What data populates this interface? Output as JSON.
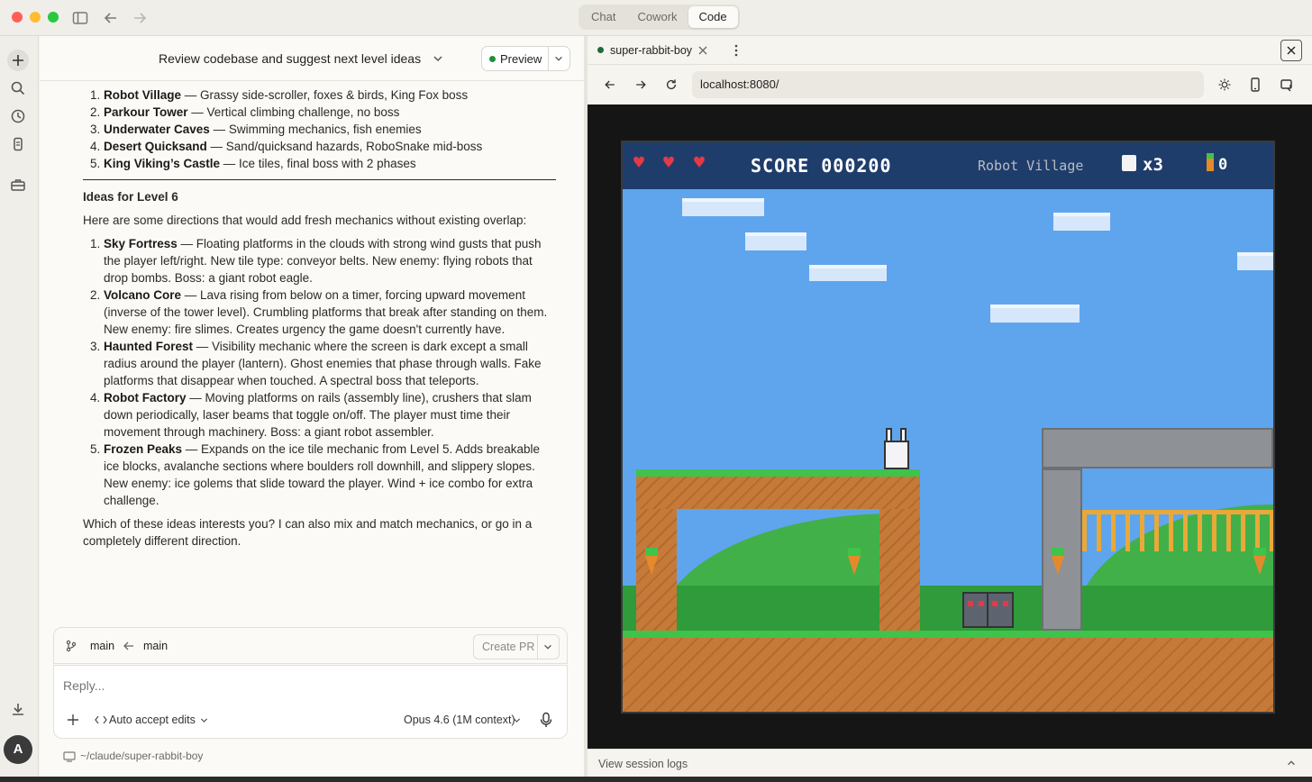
{
  "titlebar": {
    "modes": [
      "Chat",
      "Cowork",
      "Code"
    ],
    "active_mode": "Code"
  },
  "chat": {
    "title": "Review codebase and suggest next level ideas",
    "preview_label": "Preview",
    "existing_levels": [
      {
        "name": "Robot Village",
        "desc": " — Grassy side-scroller, foxes & birds, King Fox boss"
      },
      {
        "name": "Parkour Tower",
        "desc": " — Vertical climbing challenge, no boss"
      },
      {
        "name": "Underwater Caves",
        "desc": " — Swimming mechanics, fish enemies"
      },
      {
        "name": "Desert Quicksand",
        "desc": " — Sand/quicksand hazards, RoboSnake mid-boss"
      },
      {
        "name": "King Viking’s Castle",
        "desc": " — Ice tiles, final boss with 2 phases"
      }
    ],
    "ideas_heading": "Ideas for Level 6",
    "ideas_intro": "Here are some directions that would add fresh mechanics without existing overlap:",
    "ideas": [
      {
        "name": "Sky Fortress",
        "desc": " — Floating platforms in the clouds with strong wind gusts that push the player left/right. New tile type: conveyor belts. New enemy: flying robots that drop bombs. Boss: a giant robot eagle."
      },
      {
        "name": "Volcano Core",
        "desc": " — Lava rising from below on a timer, forcing upward movement (inverse of the tower level). Crumbling platforms that break after standing on them. New enemy: fire slimes. Creates urgency the game doesn't currently have."
      },
      {
        "name": "Haunted Forest",
        "desc": " — Visibility mechanic where the screen is dark except a small radius around the player (lantern). Ghost enemies that phase through walls. Fake platforms that disappear when touched. A spectral boss that teleports."
      },
      {
        "name": "Robot Factory",
        "desc": " — Moving platforms on rails (assembly line), crushers that slam down periodically, laser beams that toggle on/off. The player must time their movement through machinery. Boss: a giant robot assembler."
      },
      {
        "name": "Frozen Peaks",
        "desc": " — Expands on the ice tile mechanic from Level 5. Adds breakable ice blocks, avalanche sections where boulders roll downhill, and slippery slopes. New enemy: ice golems that slide toward the player. Wind + ice combo for extra challenge."
      }
    ],
    "closing": "Which of these ideas interests you? I can also mix and match mechanics, or go in a completely different direction.",
    "branch_from": "main",
    "branch_to": "main",
    "create_pr_label": "Create PR",
    "reply_placeholder": "Reply...",
    "auto_accept_label": "Auto accept edits",
    "model_label": "Opus 4.6 (1M context)",
    "path": "~/claude/super-rabbit-boy",
    "avatar_initial": "A"
  },
  "browser": {
    "tab_title": "super-rabbit-boy",
    "url": "localhost:8080/",
    "footer_label": "View session logs"
  },
  "game": {
    "hearts": 3,
    "score_text": "SCORE 000200",
    "level_name": "Robot Village",
    "lives_text": "x3",
    "carrots_text": "0",
    "colors": {
      "hud": "#1f3d6b",
      "sky": "#5ea5ee",
      "grass": "#3fc34a",
      "dirt": "#c57a3a",
      "stone": "#8e9196",
      "heart": "#e53945"
    }
  }
}
